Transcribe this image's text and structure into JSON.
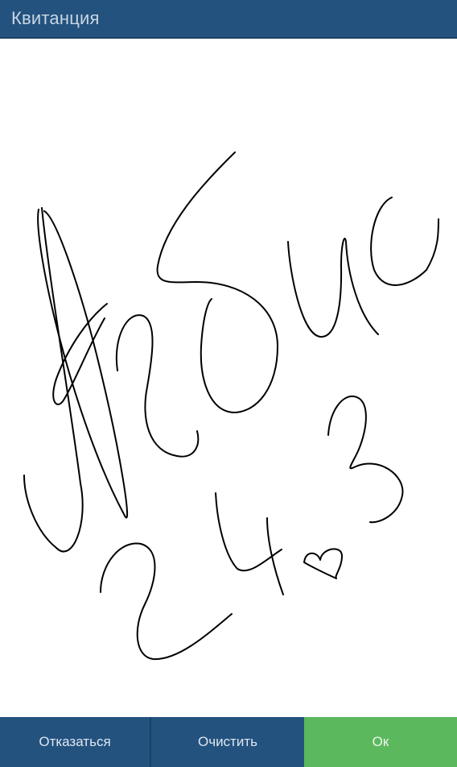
{
  "header": {
    "title": "Квитанция"
  },
  "signature": {
    "stroke_color": "#000000"
  },
  "actions": {
    "refuse_label": "Отказаться",
    "clear_label": "Очистить",
    "ok_label": "Ок"
  },
  "colors": {
    "header_bg": "#23527f",
    "ok_bg": "#5cb85c"
  }
}
